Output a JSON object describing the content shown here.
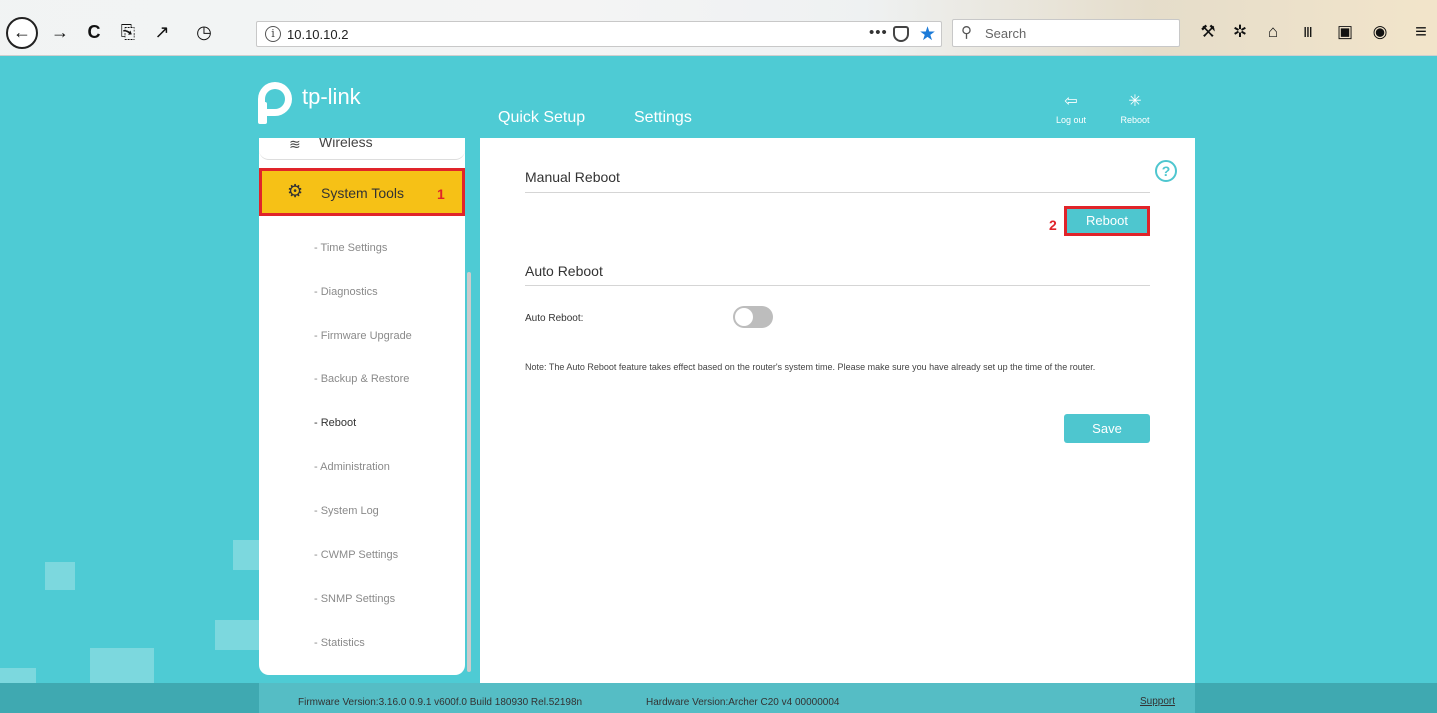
{
  "browser": {
    "back_glyph": "←",
    "forward_glyph": "→",
    "reload_glyph": "C",
    "screenshot_glyph": "⎘",
    "fullscreen_glyph": "↗",
    "history_glyph": "◷",
    "url": "10.10.10.2",
    "url_info_glyph": "i",
    "page_actions_glyph": "•••",
    "star_glyph": "★",
    "search_placeholder": "Search",
    "search_glyph": "⚲",
    "tools": [
      {
        "name": "wrench-icon",
        "glyph": "⚒"
      },
      {
        "name": "settings-icon",
        "glyph": "✲"
      },
      {
        "name": "home-icon",
        "glyph": "⌂"
      },
      {
        "name": "library-icon",
        "glyph": "Ⅲ"
      },
      {
        "name": "sidebar-icon",
        "glyph": "▣"
      },
      {
        "name": "account-icon",
        "glyph": "◉"
      },
      {
        "name": "menu-icon",
        "glyph": "≡"
      }
    ]
  },
  "header": {
    "logo_text": "tp-link",
    "tabs": [
      "Quick Setup",
      "Settings"
    ],
    "logout_label": "Log out",
    "logout_glyph": "⇦",
    "reboot_label": "Reboot",
    "reboot_glyph": "✳"
  },
  "sidebar": {
    "wireless_label": "Wireless",
    "wireless_glyph": "≋",
    "system_tools_label": "System Tools",
    "system_tools_glyph": "⚙",
    "annotation_1": "1",
    "sub_items": [
      "- Time Settings",
      "- Diagnostics",
      "- Firmware Upgrade",
      "- Backup & Restore",
      "- Reboot",
      "- Administration",
      "- System Log",
      "- CWMP Settings",
      "- SNMP Settings",
      "- Statistics"
    ],
    "active_item": "- Reboot"
  },
  "content": {
    "manual_title": "Manual Reboot",
    "help_glyph": "?",
    "annotation_2": "2",
    "reboot_button": "Reboot",
    "auto_title": "Auto Reboot",
    "auto_label": "Auto Reboot:",
    "auto_reboot_enabled": false,
    "note": "Note: The Auto Reboot feature takes effect based on the router's system time. Please make sure you have already set up the time of the router.",
    "save_button": "Save"
  },
  "footer": {
    "firmware": "Firmware Version:3.16.0 0.9.1 v600f.0 Build 180930 Rel.52198n",
    "hardware": "Hardware Version:Archer C20 v4 00000004",
    "support": "Support"
  },
  "colors": {
    "page_bg": "#4ecbd4",
    "accent": "#4ec6cf",
    "highlight": "#f6c116",
    "annotation": "#e0242a"
  }
}
